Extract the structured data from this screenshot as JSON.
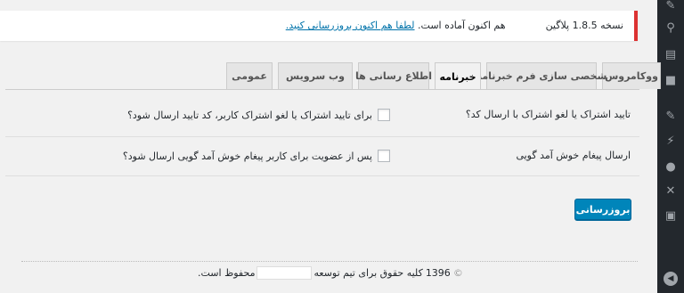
{
  "notice": {
    "prefix": "نسخه",
    "version": "1.8.5",
    "suffix": "پلاگین",
    "ready_text": "هم اکنون آماده است.",
    "link_text": "لطفا هم اکنون بروزرسانی کنید."
  },
  "tabs": [
    {
      "label": "عمومی",
      "active": false
    },
    {
      "label": "وب سرویس",
      "active": false
    },
    {
      "label": "اطلاع رسانی ها",
      "active": false
    },
    {
      "label": "خبرنامه",
      "active": true
    },
    {
      "label": "شخصی سازی فرم خبرنامه",
      "active": false
    },
    {
      "label": "ووکامروس",
      "active": false
    }
  ],
  "settings": {
    "row1": {
      "label": "تایید اشتراک یا لغو اشتراک با ارسال کد؟",
      "checkbox_label": "برای تایید اشتراک یا لغو اشتراک کاربر، کد تایید ارسال شود؟",
      "checked": false
    },
    "row2": {
      "label": "ارسال پیغام خوش آمد گویی",
      "checkbox_label": "پس از عضویت برای کاربر پیغام خوش آمد گویی ارسال شود؟",
      "checked": false
    }
  },
  "save_button": "بروزرسانی",
  "footer": {
    "copyright_symbol": "©",
    "year": "1396",
    "text_before": "کلیه حقوق برای تیم توسعه",
    "text_after": "محفوظ است."
  },
  "adminbar_icons": [
    "pin-icon",
    "wp-logo-icon",
    "pages-icon",
    "comments-icon",
    "appearance-icon",
    "plugins-icon",
    "users-icon",
    "tools-icon",
    "settings-icon",
    "collapse-icon"
  ],
  "colors": {
    "accent": "#0085ba",
    "notice_border": "#dc3232",
    "link": "#0073aa",
    "adminbar": "#23282d"
  }
}
